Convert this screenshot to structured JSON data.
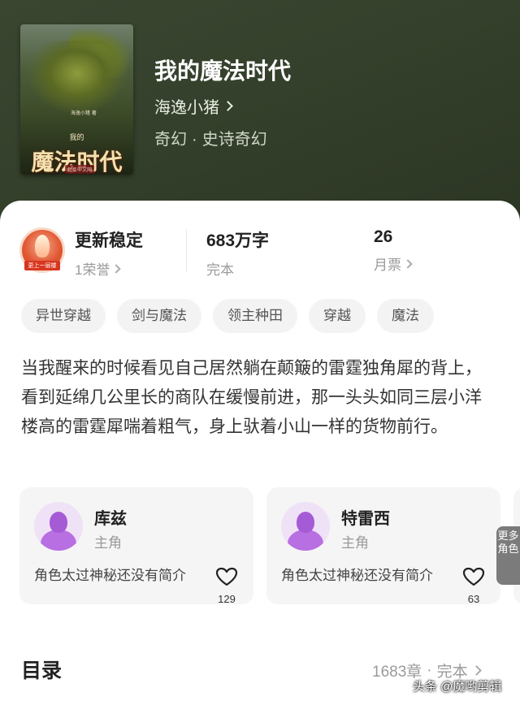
{
  "book": {
    "title": "我的魔法时代",
    "author": "海逸小猪",
    "genre_primary": "奇幻",
    "genre_separator": "·",
    "genre_secondary": "史诗奇幻",
    "cover": {
      "title": "魔法时代",
      "small_text": "我的",
      "author_text": "海逸小猪 著",
      "publisher": "起点中文网"
    }
  },
  "stats": {
    "medal_ribbon": "更上一层楼",
    "update": {
      "main": "更新稳定",
      "sub": "1荣誉"
    },
    "words": {
      "main": "683万字",
      "sub": "完本"
    },
    "tickets": {
      "main": "26",
      "sub": "月票"
    }
  },
  "tags": [
    "异世穿越",
    "剑与魔法",
    "领主种田",
    "穿越",
    "魔法"
  ],
  "description": "当我醒来的时候看见自己居然躺在颠簸的雷霆独角犀的背上，看到延绵几公里长的商队在缓慢前进，那一头头如同三层小洋楼高的雷霆犀喘着粗气，身上驮着小山一样的货物前行。",
  "characters": [
    {
      "name": "库兹",
      "role": "主角",
      "desc": "角色太过神秘还没有简介",
      "likes": "129"
    },
    {
      "name": "特雷西",
      "role": "主角",
      "desc": "角色太过神秘还没有简介",
      "likes": "63"
    }
  ],
  "more_roles": "更多角色",
  "toc": {
    "title": "目录",
    "chapters": "1683章",
    "separator": "·",
    "status": "完本"
  },
  "watermark": "头条 @魔哟剪辑",
  "colors": {
    "hero_bg": "#34402b",
    "card_bg": "#ffffff",
    "tag_bg": "#f3f3f3",
    "avatar_purple": "#a55bd6",
    "medal_red": "#e25a35"
  }
}
